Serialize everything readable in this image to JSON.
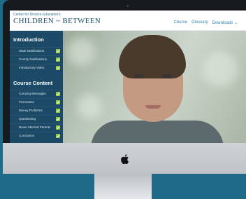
{
  "app": {
    "org_name": "Center for Divorce Education's",
    "brand_name": "CHILDREN ~ BETWEEN"
  },
  "nav": {
    "items": [
      "Course",
      "Glossary",
      "Downloads ⌄"
    ]
  },
  "sidebar": {
    "sections": [
      {
        "title": "Introduction",
        "items": [
          "State Notifications",
          "County Notifications",
          "Introductory Video"
        ]
      },
      {
        "title": "Course Content",
        "items": [
          "Carrying Messages",
          "Put Downs",
          "Money Problems",
          "Questioning",
          "Never Married Parents",
          "Conclusion"
        ]
      }
    ]
  },
  "colors": {
    "sidebar_bg": "#1c4a66",
    "accent": "#2b86b0",
    "check_green": "#8fc73e",
    "background": "#1f6a86"
  },
  "icons": {
    "check": "check-icon",
    "apple": "apple-icon"
  }
}
